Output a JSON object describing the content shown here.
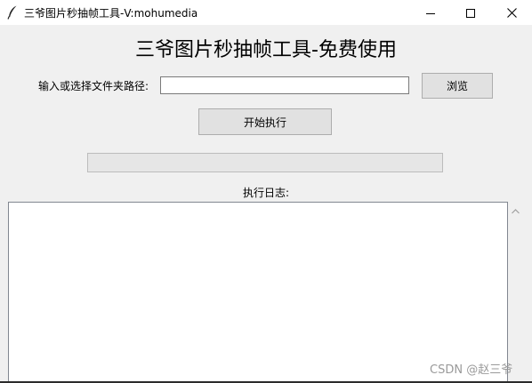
{
  "window": {
    "title": "三爷图片秒抽帧工具-V:mohumedia",
    "app_icon": "feather-icon",
    "controls": {
      "minimize_icon": "minimize-icon",
      "maximize_icon": "maximize-icon",
      "close_icon": "close-icon"
    }
  },
  "main": {
    "heading": "三爷图片秒抽帧工具-免费使用",
    "folder_label": "输入或选择文件夹路径:",
    "folder_input_value": "",
    "browse_label": "浏览",
    "start_label": "开始执行",
    "progress_percent": 0,
    "log_label": "执行日志:",
    "log_text": ""
  },
  "scrollbar": {
    "up_icon": "chevron-up-icon"
  },
  "watermark": "CSDN @赵三爷",
  "colors": {
    "window_bg": "#f0f0f0",
    "titlebar_bg": "#ffffff",
    "button_bg": "#e1e1e1",
    "button_border": "#adadad",
    "progress_bg": "#e6e6e6",
    "progress_fill": "#06b025"
  }
}
